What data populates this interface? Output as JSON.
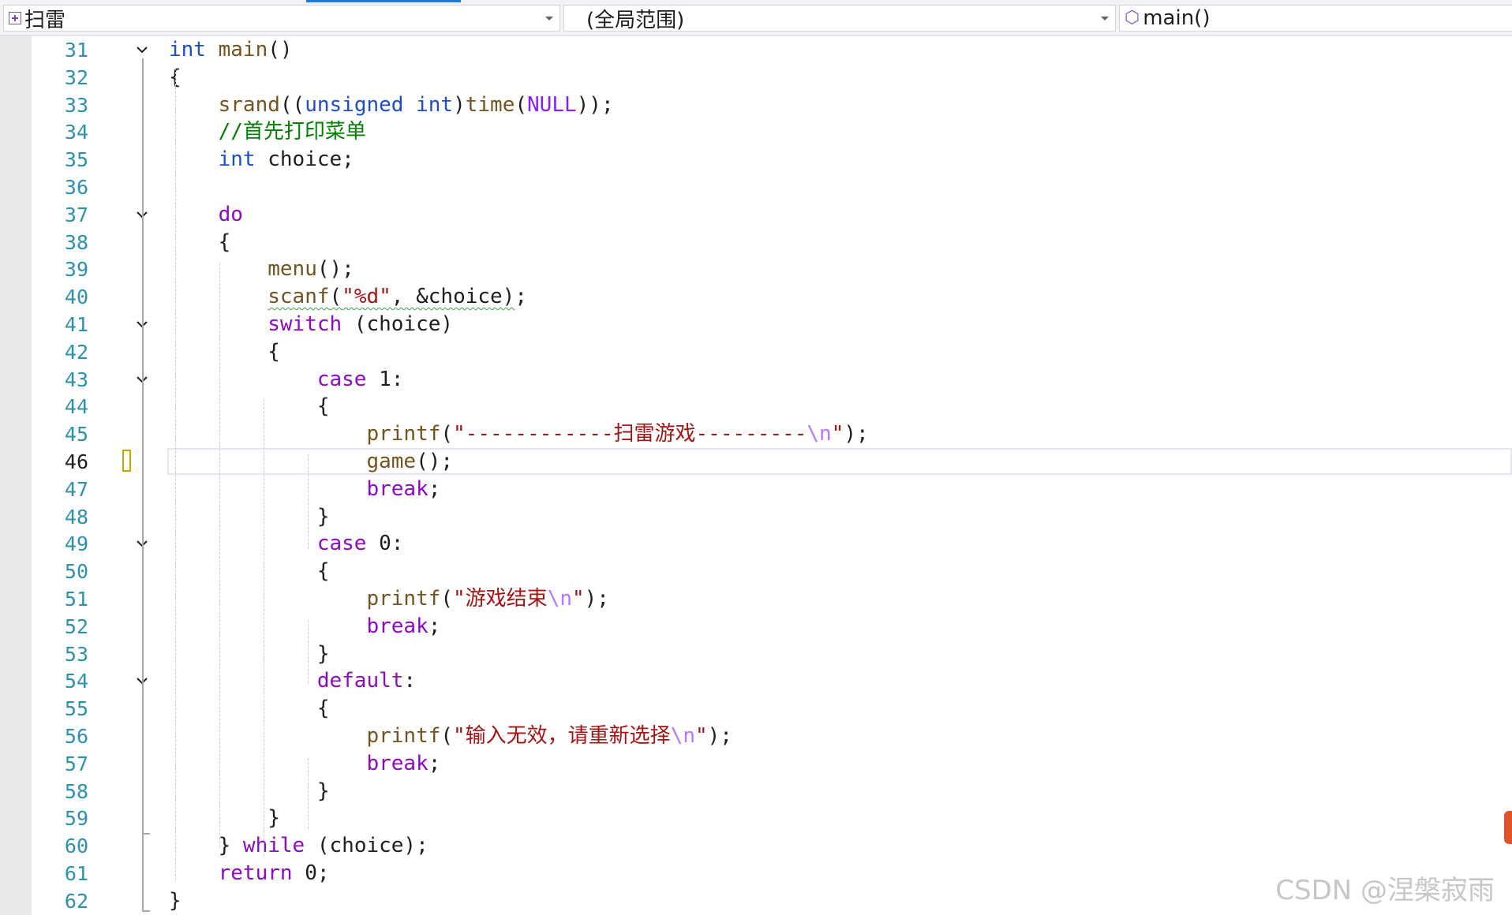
{
  "navbar": {
    "project": "扫雷",
    "scope": "(全局范围)",
    "member": "main()"
  },
  "editor": {
    "lines": [
      {
        "n": "31",
        "parts": [
          [
            "kw",
            "int"
          ],
          [
            "",
            " "
          ],
          [
            "fn",
            "main"
          ],
          [
            "",
            "()"
          ]
        ]
      },
      {
        "n": "32",
        "parts": [
          [
            "",
            "{"
          ]
        ]
      },
      {
        "n": "33",
        "parts": [
          [
            "",
            "    "
          ],
          [
            "fn",
            "srand"
          ],
          [
            "",
            "(("
          ],
          [
            "kw",
            "unsigned"
          ],
          [
            "",
            " "
          ],
          [
            "kw",
            "int"
          ],
          [
            "",
            ")"
          ],
          [
            "fn",
            "time"
          ],
          [
            "",
            "("
          ],
          [
            "mac",
            "NULL"
          ],
          [
            "",
            "));"
          ]
        ]
      },
      {
        "n": "34",
        "parts": [
          [
            "",
            "    "
          ],
          [
            "cmt",
            "//首先打印菜单"
          ]
        ]
      },
      {
        "n": "35",
        "parts": [
          [
            "",
            "    "
          ],
          [
            "kw",
            "int"
          ],
          [
            "",
            " choice;"
          ]
        ]
      },
      {
        "n": "36",
        "parts": []
      },
      {
        "n": "37",
        "parts": [
          [
            "",
            "    "
          ],
          [
            "kwc",
            "do"
          ]
        ]
      },
      {
        "n": "38",
        "parts": [
          [
            "",
            "    {"
          ]
        ]
      },
      {
        "n": "39",
        "parts": [
          [
            "",
            "        "
          ],
          [
            "fn",
            "menu"
          ],
          [
            "",
            "();"
          ]
        ]
      },
      {
        "n": "40",
        "parts": [
          [
            "",
            "        "
          ],
          [
            "fn squig",
            "scanf"
          ],
          [
            "squig",
            "("
          ],
          [
            "str squig",
            "\"%d\""
          ],
          [
            "squig",
            ", &choice)"
          ],
          [
            "",
            ";"
          ]
        ]
      },
      {
        "n": "41",
        "parts": [
          [
            "",
            "        "
          ],
          [
            "kwc",
            "switch"
          ],
          [
            "",
            " (choice)"
          ]
        ]
      },
      {
        "n": "42",
        "parts": [
          [
            "",
            "        {"
          ]
        ]
      },
      {
        "n": "43",
        "parts": [
          [
            "",
            "            "
          ],
          [
            "kwc",
            "case"
          ],
          [
            "",
            " 1:"
          ]
        ]
      },
      {
        "n": "44",
        "parts": [
          [
            "",
            "            {"
          ]
        ]
      },
      {
        "n": "45",
        "parts": [
          [
            "",
            "                "
          ],
          [
            "fn",
            "printf"
          ],
          [
            "",
            "("
          ],
          [
            "str",
            "\"------------扫雷游戏---------"
          ],
          [
            "esc",
            "\\n"
          ],
          [
            "str",
            "\""
          ],
          [
            "",
            ");"
          ]
        ]
      },
      {
        "n": "46",
        "parts": [
          [
            "",
            "                "
          ],
          [
            "fn",
            "game"
          ],
          [
            "",
            "();"
          ]
        ]
      },
      {
        "n": "47",
        "parts": [
          [
            "",
            "                "
          ],
          [
            "kwc",
            "break"
          ],
          [
            "",
            ";"
          ]
        ]
      },
      {
        "n": "48",
        "parts": [
          [
            "",
            "            }"
          ]
        ]
      },
      {
        "n": "49",
        "parts": [
          [
            "",
            "            "
          ],
          [
            "kwc",
            "case"
          ],
          [
            "",
            " 0:"
          ]
        ]
      },
      {
        "n": "50",
        "parts": [
          [
            "",
            "            {"
          ]
        ]
      },
      {
        "n": "51",
        "parts": [
          [
            "",
            "                "
          ],
          [
            "fn",
            "printf"
          ],
          [
            "",
            "("
          ],
          [
            "str",
            "\"游戏结束"
          ],
          [
            "esc",
            "\\n"
          ],
          [
            "str",
            "\""
          ],
          [
            "",
            ");"
          ]
        ]
      },
      {
        "n": "52",
        "parts": [
          [
            "",
            "                "
          ],
          [
            "kwc",
            "break"
          ],
          [
            "",
            ";"
          ]
        ]
      },
      {
        "n": "53",
        "parts": [
          [
            "",
            "            }"
          ]
        ]
      },
      {
        "n": "54",
        "parts": [
          [
            "",
            "            "
          ],
          [
            "kwc",
            "default"
          ],
          [
            "",
            ":"
          ]
        ]
      },
      {
        "n": "55",
        "parts": [
          [
            "",
            "            {"
          ]
        ]
      },
      {
        "n": "56",
        "parts": [
          [
            "",
            "                "
          ],
          [
            "fn",
            "printf"
          ],
          [
            "",
            "("
          ],
          [
            "str",
            "\"输入无效，请重新选择"
          ],
          [
            "esc",
            "\\n"
          ],
          [
            "str",
            "\""
          ],
          [
            "",
            ");"
          ]
        ]
      },
      {
        "n": "57",
        "parts": [
          [
            "",
            "                "
          ],
          [
            "kwc",
            "break"
          ],
          [
            "",
            ";"
          ]
        ]
      },
      {
        "n": "58",
        "parts": [
          [
            "",
            "            }"
          ]
        ]
      },
      {
        "n": "59",
        "parts": [
          [
            "",
            "        }"
          ]
        ]
      },
      {
        "n": "60",
        "parts": [
          [
            "",
            "    } "
          ],
          [
            "kwc",
            "while"
          ],
          [
            "",
            " (choice);"
          ]
        ]
      },
      {
        "n": "61",
        "parts": [
          [
            "",
            "    "
          ],
          [
            "kwc",
            "return"
          ],
          [
            "",
            " 0;"
          ]
        ]
      },
      {
        "n": "62",
        "parts": [
          [
            "",
            "}"
          ]
        ]
      }
    ],
    "current_line": "46",
    "fold_lines": [
      "31",
      "37",
      "41",
      "43",
      "49",
      "54"
    ]
  },
  "watermark": "CSDN @涅槃寂雨"
}
